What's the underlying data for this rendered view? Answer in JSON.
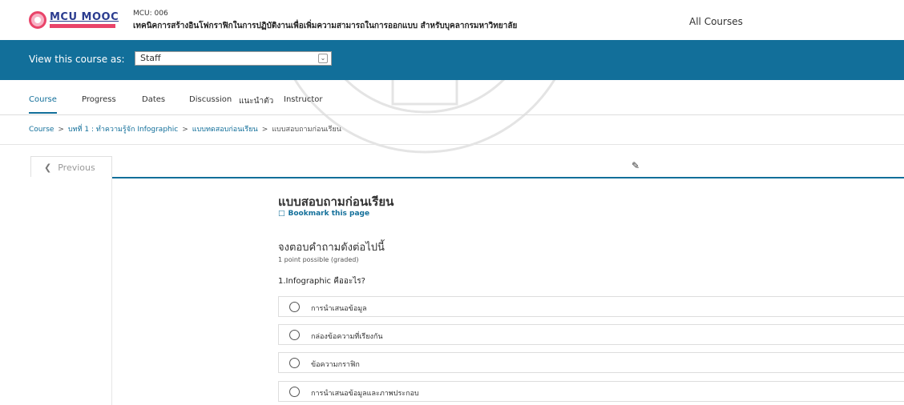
{
  "header": {
    "logo_text": "MCU MOOC",
    "course_code": "MCU: 006",
    "course_title": "เทคนิคการสร้างอินโฟกราฟิกในการปฏิบัติงานเพื่อเพิ่มความสามารถในการออกแบบ สำหรับบุคลากรมหาวิทยาลัย",
    "all_courses": "All Courses"
  },
  "staff_bar": {
    "view_label": "View this course as:",
    "selected_role": "Staff"
  },
  "tabs": [
    {
      "label": "Course",
      "active": true
    },
    {
      "label": "Progress",
      "active": false
    },
    {
      "label": "Dates",
      "active": false
    },
    {
      "label": "Discussion",
      "active": false
    },
    {
      "label": "แนะนำตัว",
      "active": false
    },
    {
      "label": "Instructor",
      "active": false
    }
  ],
  "breadcrumb": {
    "items": [
      "Course",
      "บทที่ 1 : ทำความรู้จัก Infographic",
      "แบบทดสอบก่อนเรียน"
    ],
    "current": "แบบสอบถามก่อนเรียน",
    "separator": ">"
  },
  "sequence_nav": {
    "previous_label": "Previous"
  },
  "unit": {
    "title": "แบบสอบถามก่อนเรียน",
    "bookmark_label": "Bookmark this page"
  },
  "problem": {
    "title": "จงตอบคำถามดังต่อไปนี้",
    "points": "1 point possible (graded)",
    "question": "1.Infographic คืออะไร?",
    "options": [
      "การนำเสนอข้อมูล",
      "กล่องข้อความที่เรียงกัน",
      "ข้อความกราฟิก",
      "การนำเสนอข้อมูลและภาพประกอบ"
    ]
  },
  "colors": {
    "brand_blue": "#126f9a",
    "logo_pink": "#e9446a",
    "logo_navy": "#2b3c8f"
  }
}
